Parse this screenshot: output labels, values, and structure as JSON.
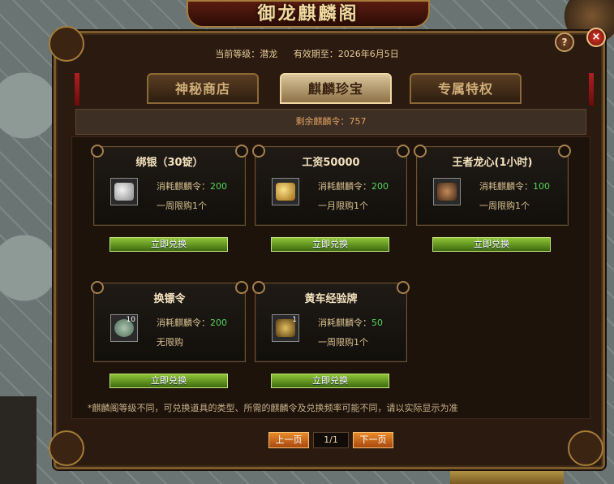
{
  "window": {
    "title": "御龙麒麟阁",
    "help_label": "?",
    "close_label": "×"
  },
  "header": {
    "level_text": "当前等级：潜龙",
    "expiry_text": "有效期至：2026年6月5日"
  },
  "tabs": [
    {
      "label": "神秘商店",
      "active": false
    },
    {
      "label": "麒麟珍宝",
      "active": true
    },
    {
      "label": "专属特权",
      "active": false
    }
  ],
  "balance": {
    "text": "剩余麒麟令：757"
  },
  "items": [
    {
      "name": "绑银（30锭）",
      "icon": "silver-ingot-icon",
      "count": "",
      "cost_label": "消耗麒麟令：",
      "cost": "200",
      "limit": "一周限购1个",
      "button": "立即兑换"
    },
    {
      "name": "工资50000",
      "icon": "gold-coins-icon",
      "count": "",
      "cost_label": "消耗麒麟令：",
      "cost": "200",
      "limit": "一月限购1个",
      "button": "立即兑换"
    },
    {
      "name": "王者龙心(1小时)",
      "icon": "dragon-heart-icon",
      "count": "",
      "cost_label": "消耗麒麟令：",
      "cost": "100",
      "limit": "一周限购1个",
      "button": "立即兑换"
    },
    {
      "name": "换镖令",
      "icon": "escort-token-icon",
      "count": "10",
      "cost_label": "消耗麒麟令：",
      "cost": "200",
      "limit": "无限购",
      "button": "立即兑换"
    },
    {
      "name": "黄车经验牌",
      "icon": "gold-cart-icon",
      "count": "1",
      "cost_label": "消耗麒麟令：",
      "cost": "50",
      "limit": "一周限购1个",
      "button": "立即兑换"
    }
  ],
  "footnote": "*麒麟阁等级不同，可兑换道具的类型、所需的麒麟令及兑换频率可能不同，请以实际显示为准",
  "pagination": {
    "prev_label": "上一页",
    "page_text": "1/1",
    "next_label": "下一页"
  },
  "colors": {
    "accent_gold": "#f3d9a0",
    "cost_green": "#59d45c",
    "exchange_button": "#6fa028",
    "page_button": "#d8701e"
  }
}
